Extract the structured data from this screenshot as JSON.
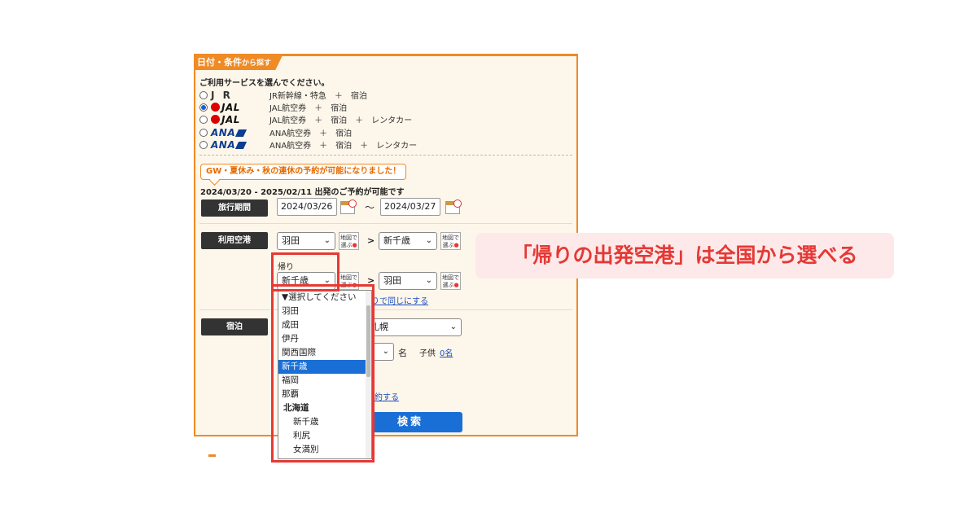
{
  "panel": {
    "tab_title": "日付・条件",
    "tab_suffix": "から探す",
    "intro": "ご利用サービスを選んでください。"
  },
  "services": [
    {
      "logo": "J R",
      "logo_type": "jr",
      "text": "JR新幹線・特急　＋　宿泊",
      "selected": false
    },
    {
      "logo": "JAL",
      "logo_type": "jal",
      "text": "JAL航空券　＋　宿泊",
      "selected": true
    },
    {
      "logo": "JAL",
      "logo_type": "jal",
      "text": "JAL航空券　＋　宿泊　＋　レンタカー",
      "selected": false
    },
    {
      "logo": "ANA",
      "logo_type": "ana",
      "text": "ANA航空券　＋　宿泊",
      "selected": false
    },
    {
      "logo": "ANA",
      "logo_type": "ana",
      "text": "ANA航空券　＋　宿泊　＋　レンタカー",
      "selected": false
    }
  ],
  "notice": "GW・夏休み・秋の連休の予約が可能になりました！",
  "booking_range": "2024/03/20 - 2025/02/11 出発のご予約が可能です",
  "travel_period": {
    "label": "旅行期間",
    "start": "2024/03/26",
    "separator": "〜",
    "end": "2024/03/27"
  },
  "airport": {
    "label": "利用空港",
    "outbound_from": "羽田",
    "outbound_to": "新千歳",
    "return_label": "帰り",
    "return_from": "新千歳",
    "return_to": "羽田",
    "arrow": ">",
    "map_button": "地図で\n選ぶ",
    "same_link_partial": "りで同じにする"
  },
  "lodging": {
    "label": "宿泊",
    "area_partial": "札幌",
    "adult_unit": "名",
    "child_label": "子供",
    "child_value": "0名",
    "reserve_link_partial": "約する",
    "search_partial": "検索"
  },
  "dropdown": {
    "items": [
      {
        "label": "▼選択してください",
        "kind": "placeholder"
      },
      {
        "label": "羽田",
        "kind": "item"
      },
      {
        "label": "成田",
        "kind": "item"
      },
      {
        "label": "伊丹",
        "kind": "item"
      },
      {
        "label": "関西国際",
        "kind": "item"
      },
      {
        "label": "新千歳",
        "kind": "selected"
      },
      {
        "label": "福岡",
        "kind": "item"
      },
      {
        "label": "那覇",
        "kind": "item"
      },
      {
        "label": "北海道",
        "kind": "group"
      },
      {
        "label": "新千歳",
        "kind": "sub"
      },
      {
        "label": "利尻",
        "kind": "sub"
      },
      {
        "label": "女満別",
        "kind": "sub"
      }
    ]
  },
  "callout": "「帰りの出発空港」は全国から選べる",
  "colors": {
    "accent": "#f08a24",
    "highlight": "#e53935",
    "callout_bg": "#fde9ea",
    "selection": "#1a6fd6"
  }
}
